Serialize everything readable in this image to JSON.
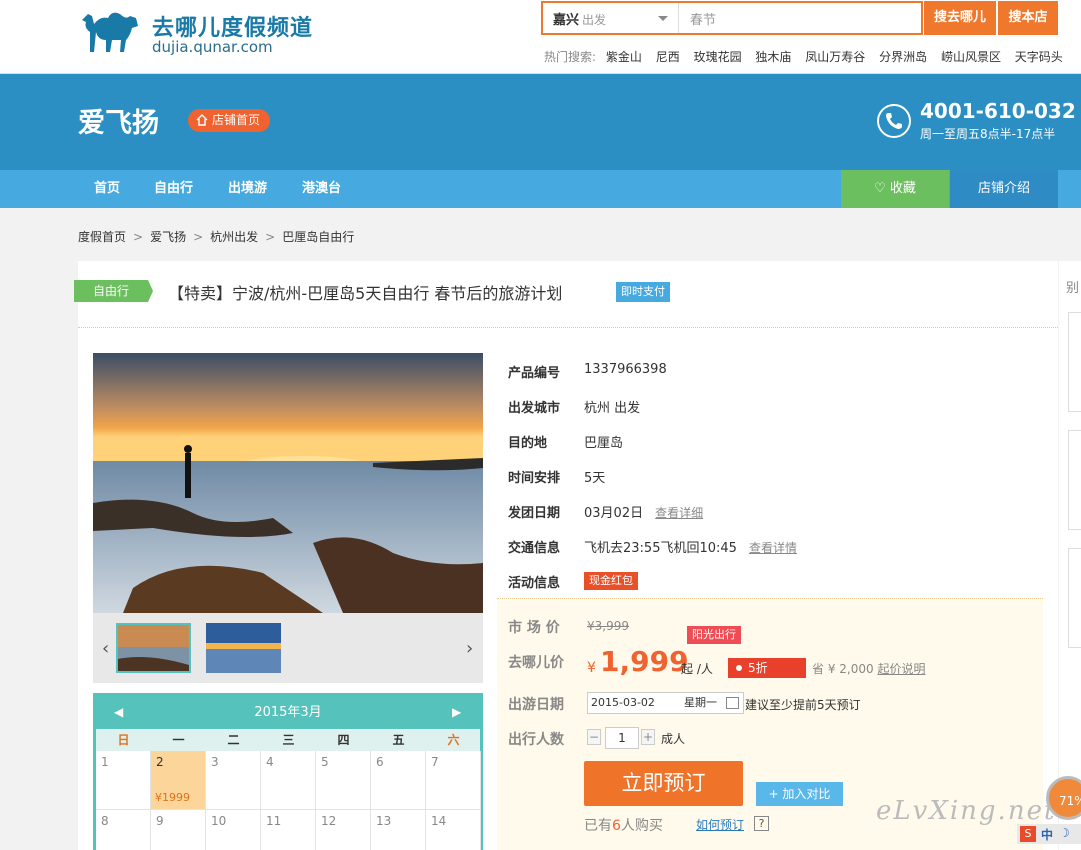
{
  "header": {
    "logo_name": "去哪儿度假频道",
    "logo_domain": "dujia.qunar.com",
    "search": {
      "city": "嘉兴",
      "city_suffix": "出发",
      "keyword": "春节",
      "btn_search": "搜去哪儿",
      "btn_store": "搜本店"
    },
    "hot": {
      "label": "热门搜索:",
      "items": [
        "紫金山",
        "尼西",
        "玫瑰花园",
        "独木庙",
        "凤山万寿谷",
        "分界洲岛",
        "崂山风景区",
        "天字码头"
      ]
    }
  },
  "store": {
    "name": "爱飞扬",
    "home_btn": "店铺首页",
    "phone": "4001-610-032",
    "hours": "周一至周五8点半-17点半"
  },
  "nav": {
    "items": [
      "首页",
      "自由行",
      "出境游",
      "港澳台"
    ],
    "favorite": "收藏",
    "intro": "店铺介绍"
  },
  "breadcrumb": [
    "度假首页",
    "爱飞扬",
    "杭州出发",
    "巴厘岛自由行"
  ],
  "product": {
    "type_tag": "自由行",
    "title": "【特卖】宁波/杭州-巴厘岛5天自由行 春节后的旅游计划",
    "instant_tag": "即时支付",
    "fields": {
      "code_label": "产品编号",
      "code": "1337966398",
      "from_label": "出发城市",
      "from": "杭州 出发",
      "dest_label": "目的地",
      "dest": "巴厘岛",
      "days_label": "时间安排",
      "days": "5天",
      "depart_label": "发团日期",
      "depart": "03月02日",
      "depart_link": "查看详细",
      "traffic_label": "交通信息",
      "traffic": "飞机去23:55飞机回10:45",
      "traffic_link": "查看详情",
      "promo_label": "活动信息",
      "promo": "现金红包"
    },
    "pricing": {
      "market_label": "市 场 价",
      "market_price": "¥3,999",
      "sunny_tag": "阳光出行",
      "qunar_label": "去哪儿价",
      "currency": "¥",
      "price": "1,999",
      "per_person": "起 /人",
      "discount": "5折",
      "save_text": "省 ¥ 2,000",
      "save_link": "起价说明"
    },
    "booking": {
      "date_label": "出游日期",
      "date": "2015-03-02",
      "weekday": "星期一",
      "advance": "建议至少提前5天预订",
      "count_label": "出行人数",
      "count": "1",
      "minus": "−",
      "plus": "+",
      "unit": "成人",
      "book_btn": "立即预订",
      "compare_btn": "+ 加入对比",
      "bought_prefix": "已有",
      "bought_count": "6",
      "bought_suffix": "人购买",
      "how_link": "如何预订",
      "help": "?"
    }
  },
  "calendar": {
    "month": "2015年3月",
    "weekdays": [
      "日",
      "一",
      "二",
      "三",
      "四",
      "五",
      "六"
    ],
    "row1": [
      "1",
      "2",
      "3",
      "4",
      "5",
      "6",
      "7"
    ],
    "row2": [
      "8",
      "9",
      "10",
      "11",
      "12",
      "13",
      "14"
    ],
    "selected_price": "¥1999"
  },
  "side": {
    "label": "别"
  },
  "overlay": {
    "watermark": "eLvXing.net",
    "badge": "71%",
    "ime_s": "S",
    "ime_zh": "中",
    "ime_moon": "☽"
  }
}
